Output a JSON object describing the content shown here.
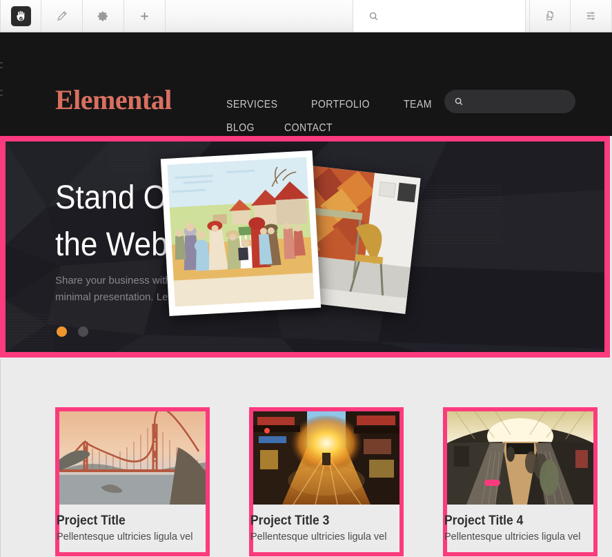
{
  "toolbar": {
    "logo_label": "concrete5-hand-logo",
    "buttons": [
      {
        "name": "edit-pencil",
        "label": "Edit"
      },
      {
        "name": "gear",
        "label": "Settings"
      },
      {
        "name": "plus",
        "label": "Add"
      }
    ],
    "search_placeholder": "",
    "search_value": "",
    "right_buttons": [
      {
        "name": "pages-copy",
        "label": "Sitemap"
      },
      {
        "name": "sliders",
        "label": "Preferences"
      }
    ]
  },
  "site": {
    "logo": "Elemental",
    "logo_color": "#d9705f",
    "nav": [
      {
        "label": "SERVICES"
      },
      {
        "label": "PORTFOLIO"
      },
      {
        "label": "TEAM"
      },
      {
        "label": "BLOG"
      },
      {
        "label": "CONTACT"
      }
    ],
    "header_search_placeholder": "",
    "header_search_value": ""
  },
  "hero": {
    "heading": "Stand Out on the Web",
    "paragraph": "Share your business with an impressive, yet minimal presentation. Let your customers",
    "slides": [
      {
        "active": true,
        "color": "#f0952e"
      },
      {
        "active": false,
        "color": "#4b4b50"
      }
    ],
    "highlight_color": "#fc3a7e",
    "background_color": "#1e1e24",
    "photo_a_caption": "vintage-village-children-illustration",
    "photo_b_caption": "interior-chairs-diamond-wall-photo"
  },
  "projects": [
    {
      "title": "Project Title",
      "body": "Pellentesque ultricies ligula vel",
      "image": "golden-gate-bridge-sunset"
    },
    {
      "title": "Project Title 3",
      "body": "Pellentesque ultricies ligula vel",
      "image": "city-street-sunset"
    },
    {
      "title": "Project Title 4",
      "body": "Pellentesque ultricies ligula vel",
      "image": "subway-escalator-tunnel"
    }
  ],
  "colors": {
    "edit_highlight": "#fc3a7e",
    "band_background": "#ebebeb",
    "header_background": "#151516"
  }
}
